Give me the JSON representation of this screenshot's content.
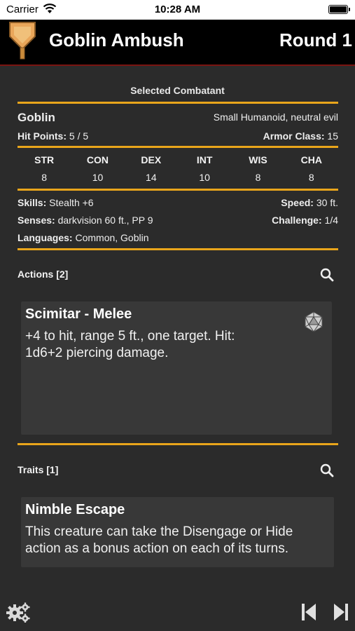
{
  "status_bar": {
    "carrier": "Carrier",
    "time": "10:28 AM"
  },
  "header": {
    "title": "Goblin Ambush",
    "round": "Round 1"
  },
  "selected": {
    "heading": "Selected Combatant",
    "name": "Goblin",
    "type": "Small Humanoid, neutral evil",
    "hp_label": "Hit Points:",
    "hp_value": "5 / 5",
    "ac_label": "Armor Class:",
    "ac_value": "15",
    "abilities": [
      {
        "abbr": "STR",
        "value": "8"
      },
      {
        "abbr": "CON",
        "value": "10"
      },
      {
        "abbr": "DEX",
        "value": "14"
      },
      {
        "abbr": "INT",
        "value": "10"
      },
      {
        "abbr": "WIS",
        "value": "8"
      },
      {
        "abbr": "CHA",
        "value": "8"
      }
    ],
    "skills_label": "Skills:",
    "skills_value": "Stealth +6",
    "speed_label": "Speed:",
    "speed_value": "30 ft.",
    "senses_label": "Senses:",
    "senses_value": "darkvision 60 ft., PP 9",
    "challenge_label": "Challenge:",
    "challenge_value": "1/4",
    "languages_label": "Languages:",
    "languages_value": "Common, Goblin"
  },
  "actions": {
    "header": "Actions [2]",
    "items": [
      {
        "title": "Scimitar - Melee",
        "line1": "+4 to hit, range 5 ft., one target. Hit:",
        "line2": "1d6+2 piercing damage."
      }
    ]
  },
  "traits": {
    "header": "Traits [1]",
    "items": [
      {
        "title": "Nimble Escape",
        "line1": "This creature can take the Disengage or Hide",
        "line2": "action as a bonus action on each of its turns."
      }
    ]
  },
  "colors": {
    "accent": "#e9a51b",
    "header_border": "#7a1410",
    "background": "#2b2b2b"
  },
  "icons": [
    "wifi-icon",
    "battery-icon",
    "shield-icon",
    "search-icon",
    "d20-icon",
    "gear-icon",
    "skip-back-icon",
    "skip-forward-icon"
  ]
}
